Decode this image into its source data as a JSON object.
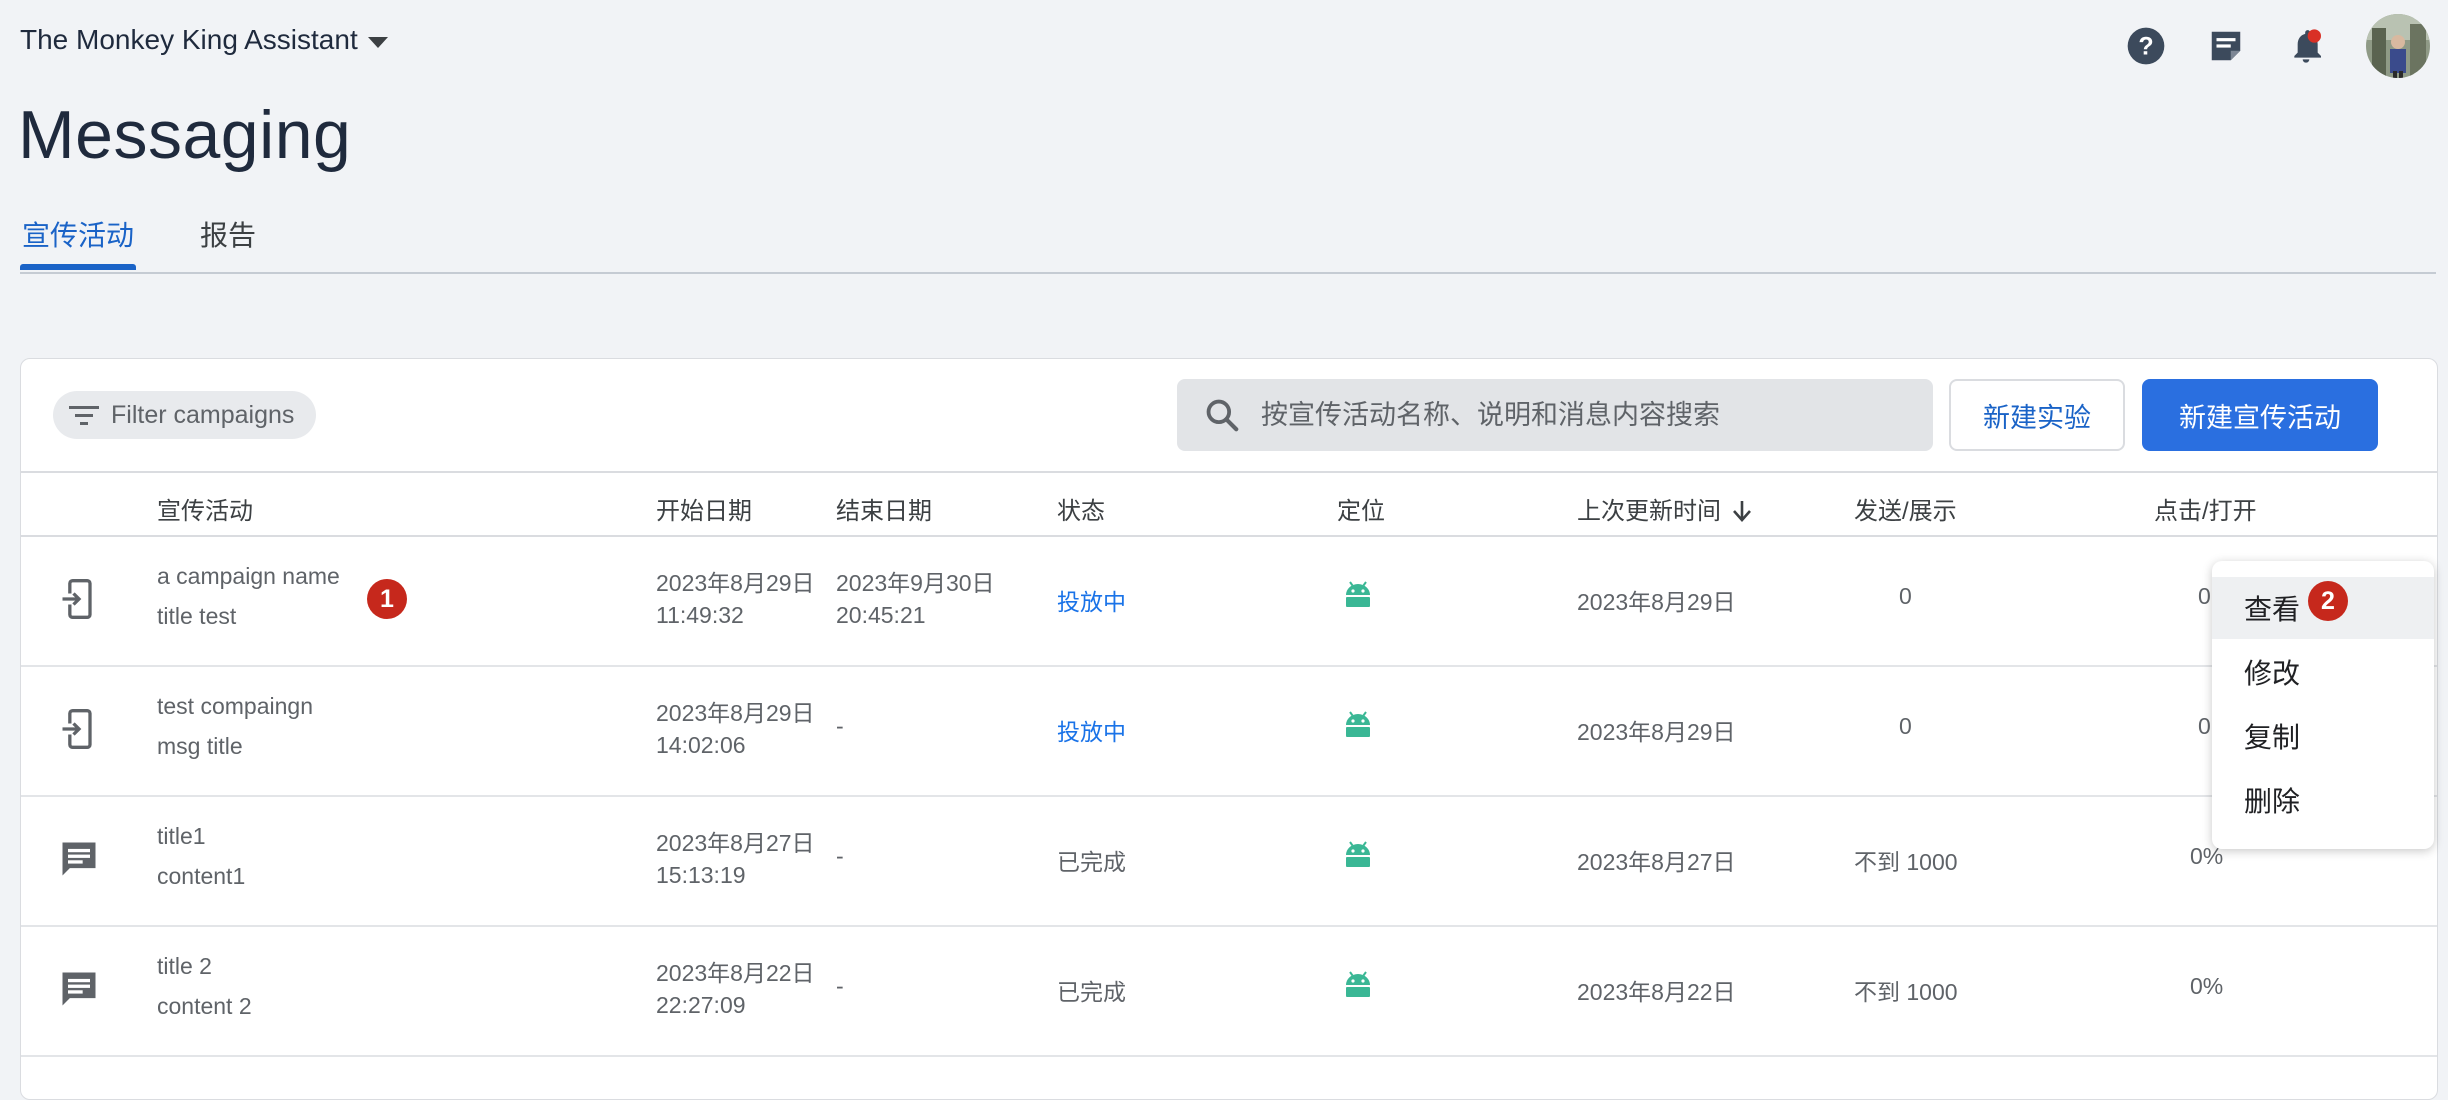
{
  "app": {
    "project_name": "The Monkey King Assistant"
  },
  "page": {
    "title": "Messaging"
  },
  "tabs": [
    {
      "label": "宣传活动",
      "active": true
    },
    {
      "label": "报告",
      "active": false
    }
  ],
  "toolbar": {
    "filter_label": "Filter campaigns",
    "search_placeholder": "按宣传活动名称、说明和消息内容搜索",
    "new_experiment_label": "新建实验",
    "new_campaign_label": "新建宣传活动"
  },
  "table": {
    "headers": {
      "campaign": "宣传活动",
      "start_date": "开始日期",
      "end_date": "结束日期",
      "status": "状态",
      "targeting": "定位",
      "last_updated": "上次更新时间",
      "sends": "发送/展示",
      "clicks": "点击/打开"
    },
    "rows": [
      {
        "icon": "in-app-message-icon",
        "name": "a campaign name",
        "title": "title test",
        "start_date": "2023年8月29日",
        "start_time": "11:49:32",
        "end_date": "2023年9月30日",
        "end_time": "20:45:21",
        "status": "投放中",
        "status_active": true,
        "targeting_icon": "android-icon",
        "last_updated": "2023年8月29日",
        "sends": "0",
        "clicks": "0"
      },
      {
        "icon": "in-app-message-icon",
        "name": "test compaingn",
        "title": "msg title",
        "start_date": "2023年8月29日",
        "start_time": "14:02:06",
        "end_date": "-",
        "end_time": "",
        "status": "投放中",
        "status_active": true,
        "targeting_icon": "android-icon",
        "last_updated": "2023年8月29日",
        "sends": "0",
        "clicks": "0"
      },
      {
        "icon": "notification-message-icon",
        "name": "title1",
        "title": "content1",
        "start_date": "2023年8月27日",
        "start_time": "15:13:19",
        "end_date": "-",
        "end_time": "",
        "status": "已完成",
        "status_active": false,
        "targeting_icon": "android-icon",
        "last_updated": "2023年8月27日",
        "sends": "不到 1000",
        "clicks": "0%"
      },
      {
        "icon": "notification-message-icon",
        "name": "title 2",
        "title": "content 2",
        "start_date": "2023年8月22日",
        "start_time": "22:27:09",
        "end_date": "-",
        "end_time": "",
        "status": "已完成",
        "status_active": false,
        "targeting_icon": "android-icon",
        "last_updated": "2023年8月22日",
        "sends": "不到 1000",
        "clicks": "0%"
      }
    ]
  },
  "context_menu": {
    "items": [
      "查看",
      "修改",
      "复制",
      "删除"
    ]
  },
  "annotations": {
    "marker_1": "1",
    "marker_2": "2"
  },
  "colors": {
    "accent": "#1a63c7",
    "primary_button": "#2a6fe0",
    "status_active": "#1a73e8",
    "android": "#3ab795",
    "marker": "#c6281c"
  }
}
